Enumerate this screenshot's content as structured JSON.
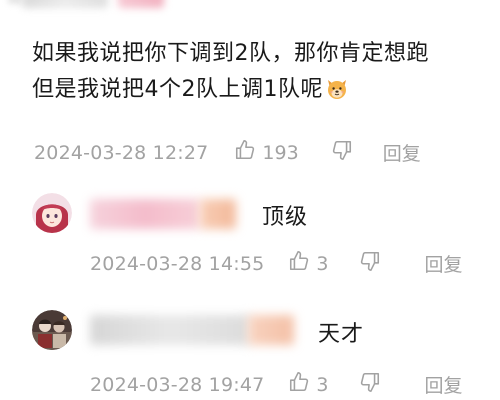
{
  "main_comment": {
    "line1": "如果我说把你下调到2队，那你肯定想跑",
    "line2": "但是我说把4个2队上调1队呢",
    "emoji": "dog-face-icon",
    "timestamp": "2024-03-28 12:27",
    "likes": "193",
    "reply_label": "回复"
  },
  "replies": [
    {
      "text": "顶级",
      "timestamp": "2024-03-28 14:55",
      "likes": "3",
      "reply_label": "回复"
    },
    {
      "text": "天才",
      "timestamp": "2024-03-28 19:47",
      "likes": "3",
      "reply_label": "回复"
    }
  ],
  "colors": {
    "text": "#1a1a1a",
    "meta": "#a2a2a2",
    "background": "#ffffff"
  }
}
